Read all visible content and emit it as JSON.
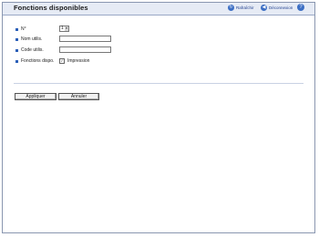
{
  "header": {
    "title": "Fonctions disponibles",
    "refresh_label": "Rafraîchir",
    "logout_label": "Déconnexion",
    "help_icon": "help-icon"
  },
  "form": {
    "number": {
      "label": "N°",
      "value": "1"
    },
    "user_name": {
      "label": "Nom utilis.",
      "value": ""
    },
    "user_code": {
      "label": "Code utilis.",
      "value": ""
    },
    "functions": {
      "label": "Fonctions dispo.",
      "checkbox_label": "Impression",
      "checked": true
    }
  },
  "buttons": {
    "apply": "Appliquer",
    "cancel": "Annuler"
  },
  "colors": {
    "header_bg": "#e6ebf5",
    "accent": "#2b5fb8"
  }
}
